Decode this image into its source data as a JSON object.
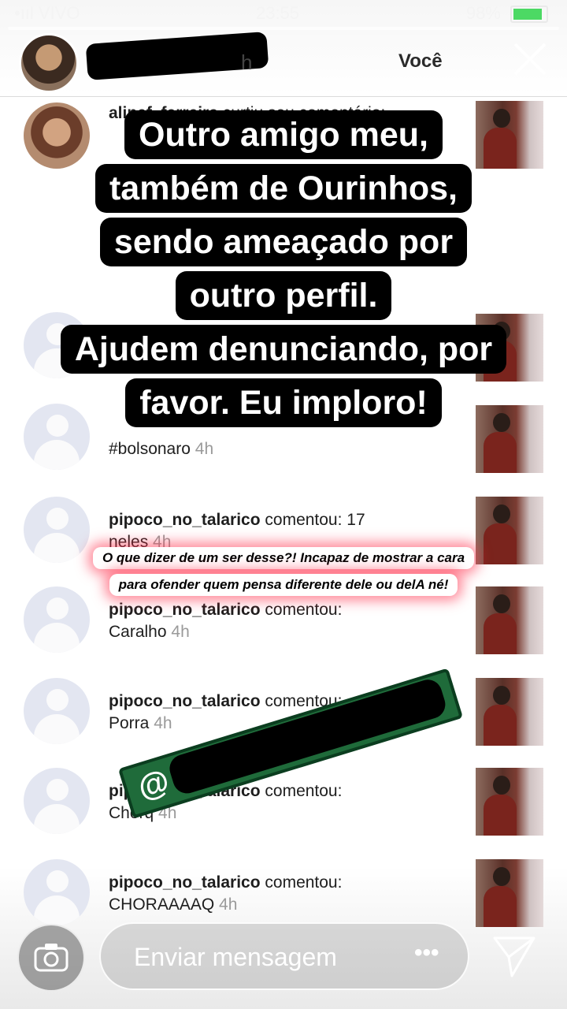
{
  "status": {
    "carrier": "•ııl VIVO",
    "time": "23:55",
    "battery": "98%"
  },
  "header": {
    "time_suffix": "h",
    "tab_label": "Você"
  },
  "caption": [
    "Outro amigo meu,",
    "também de Ourinhos,",
    "sendo ameaçado por",
    "outro perfil.",
    "Ajudem denunciando, por",
    "favor. Eu imploro!"
  ],
  "rows": [
    {
      "user": "alinef_ferreira",
      "action": "curtiu seu comentário:",
      "extra": "",
      "time": ""
    },
    {
      "user": "",
      "action": "",
      "extra": "#bolsonaro",
      "time": "4h"
    },
    {
      "user": "pipoco_no_talarico",
      "action": "comentou: 17",
      "extra": "neles",
      "time": "4h"
    },
    {
      "user": "pipoco_no_talarico",
      "action": "comentou:",
      "extra": "Caralho",
      "time": "4h"
    },
    {
      "user": "pipoco_no_talarico",
      "action": "comentou:",
      "extra": "Porra",
      "time": "4h"
    },
    {
      "user": "pipoco_no_talarico",
      "action": "comentou:",
      "extra": "Chorq",
      "time": "4h"
    },
    {
      "user": "pipoco_no_talarico",
      "action": "comentou:",
      "extra": "CHORAAAAQ",
      "time": "4h"
    }
  ],
  "quote": {
    "line1": "O que dizer de um ser desse?! Incapaz de mostrar a cara",
    "line2": "para ofender quem pensa diferente dele ou delA né!"
  },
  "mention": {
    "prefix": "@"
  },
  "bottom": {
    "placeholder": "Enviar mensagem",
    "more": "•••"
  }
}
